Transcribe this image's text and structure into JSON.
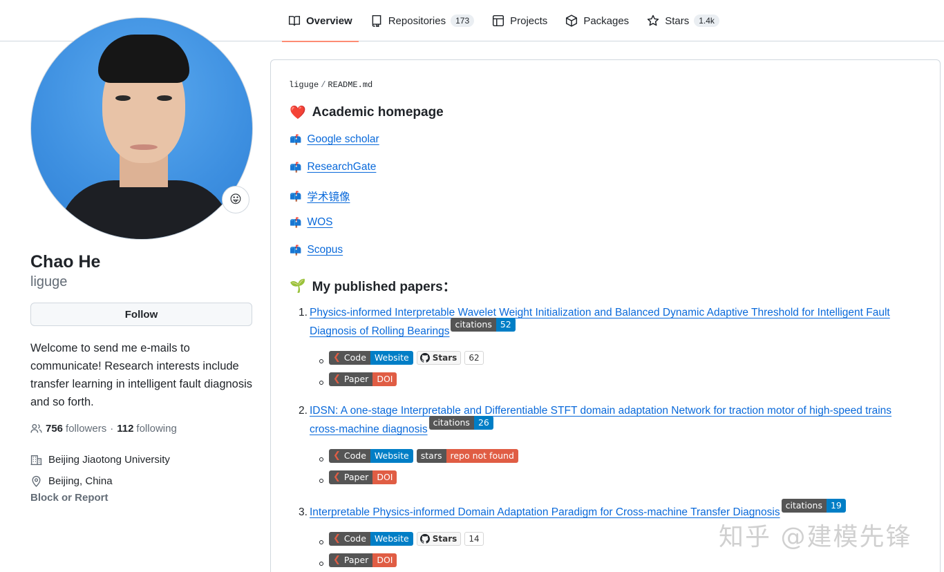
{
  "nav": {
    "tabs": [
      {
        "label": "Overview",
        "count": ""
      },
      {
        "label": "Repositories",
        "count": "173"
      },
      {
        "label": "Projects",
        "count": ""
      },
      {
        "label": "Packages",
        "count": ""
      },
      {
        "label": "Stars",
        "count": "1.4k"
      }
    ]
  },
  "profile": {
    "status_emoji": "😛",
    "fullname": "Chao He",
    "login": "liguge",
    "follow_label": "Follow",
    "bio": "Welcome to send me e-mails to communicate! Research interests include transfer learning in intelligent fault diagnosis and so forth.",
    "followers_count": "756",
    "followers_label": "followers",
    "separator": "·",
    "following_count": "112",
    "following_label": "following",
    "organization": "Beijing Jiaotong University",
    "location": "Beijing, China",
    "block_label": "Block or Report"
  },
  "readme": {
    "owner": "liguge",
    "slash": "/",
    "file": "README.md",
    "heading1": {
      "emoji": "❤️",
      "text": "Academic homepage"
    },
    "links": [
      {
        "emoji": "📫",
        "label": "Google scholar"
      },
      {
        "emoji": "📫",
        "label": "ResearchGate"
      },
      {
        "emoji": "📫",
        "label": "学术镜像"
      },
      {
        "emoji": "📫",
        "label": "WOS"
      },
      {
        "emoji": "📫",
        "label": "Scopus"
      }
    ],
    "heading2": {
      "emoji": "🌱",
      "text": "My published papers："
    },
    "papers": [
      {
        "num": "1.",
        "title": "Physics-informed Interpretable Wavelet Weight Initialization and Balanced Dynamic Adaptive Threshold for Intelligent Fault Diagnosis of Rolling Bearings",
        "citations_label": "citations",
        "citations": "52",
        "code_label": "Code",
        "website_label": "Website",
        "stars_label": "Stars",
        "stars": "62",
        "stars_error": "",
        "paper_label": "Paper",
        "doi_label": "DOI"
      },
      {
        "num": "2.",
        "title": "IDSN: A one-stage Interpretable and Differentiable STFT domain adaptation Network for traction motor of high-speed trains cross-machine diagnosis",
        "citations_label": "citations",
        "citations": "26",
        "code_label": "Code",
        "website_label": "Website",
        "stars_label": "stars",
        "stars": "",
        "stars_error": "repo not found",
        "paper_label": "Paper",
        "doi_label": "DOI"
      },
      {
        "num": "3.",
        "title": "Interpretable Physics-informed Domain Adaptation Paradigm for Cross-machine Transfer Diagnosis",
        "citations_label": "citations",
        "citations": "19",
        "code_label": "Code",
        "website_label": "Website",
        "stars_label": "Stars",
        "stars": "14",
        "stars_error": "",
        "paper_label": "Paper",
        "doi_label": "DOI"
      }
    ]
  },
  "watermark": "知乎 @建模先锋",
  "colors": {
    "accent": "#fd8c73",
    "link": "#0969da",
    "badge_blue": "#007ec6",
    "badge_red": "#e05d44",
    "badge_gray": "#555555"
  }
}
